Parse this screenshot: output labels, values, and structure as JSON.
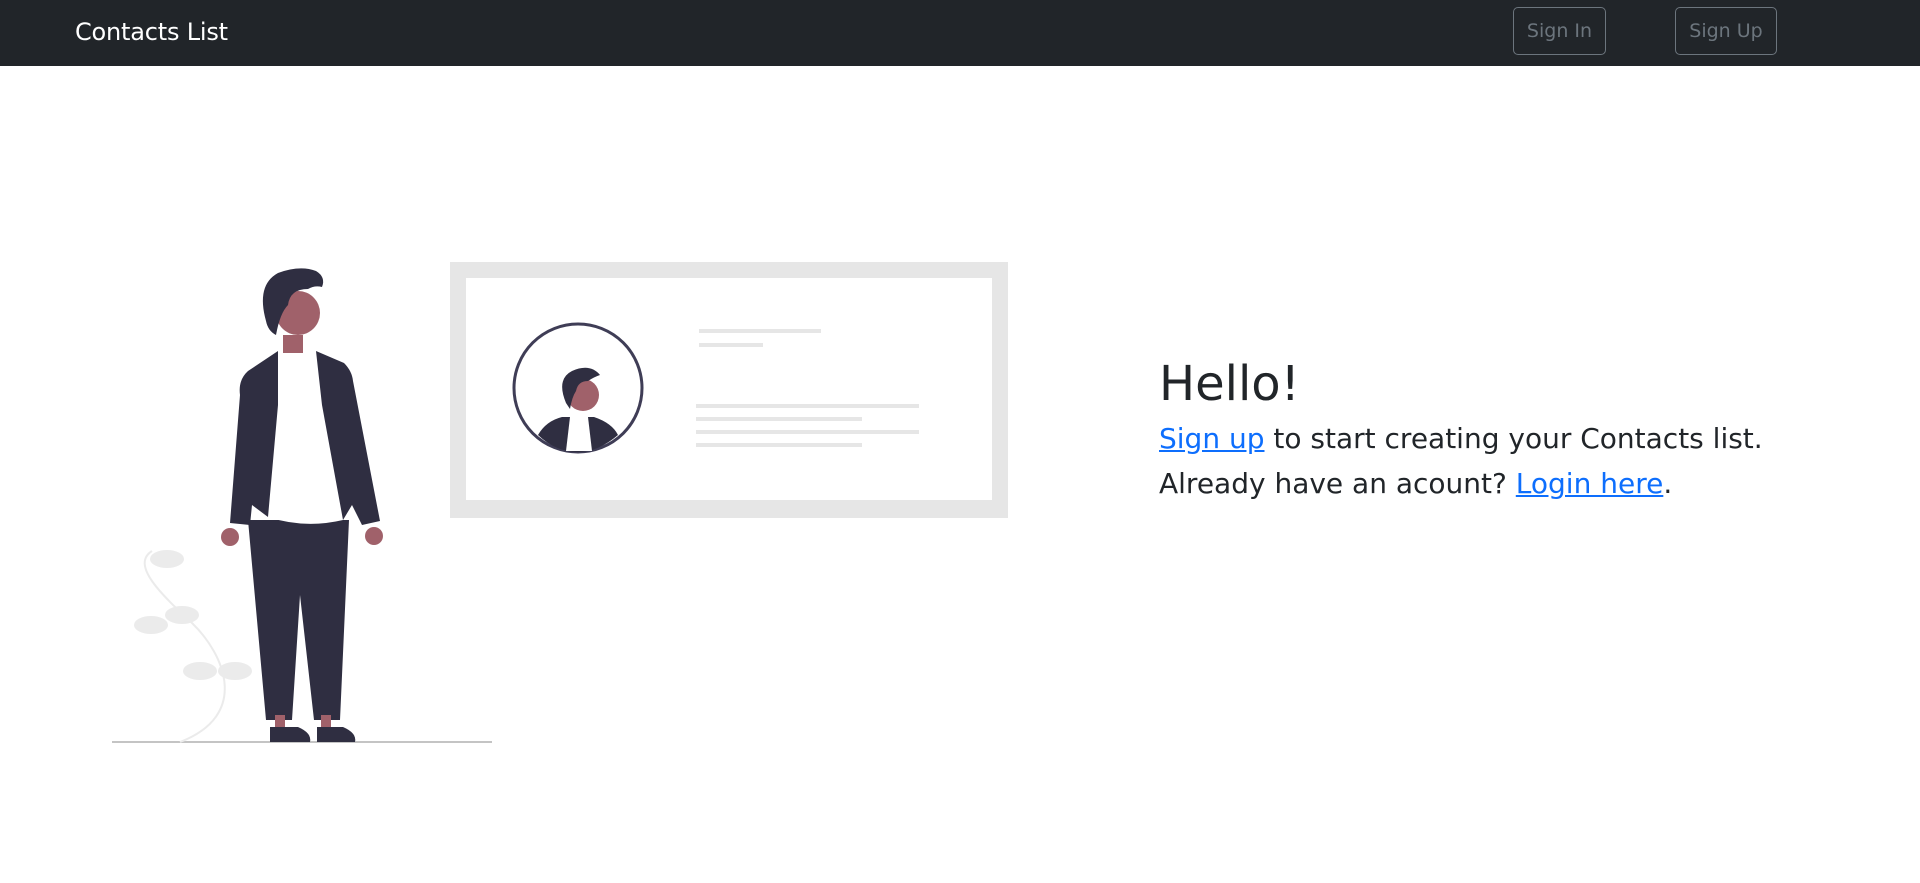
{
  "navbar": {
    "brand": "Contacts List",
    "sign_in_label": "Sign In",
    "sign_up_label": "Sign Up",
    "background": "#212529"
  },
  "hero": {
    "title": "Hello!",
    "line1": {
      "link": "Sign up",
      "text": " to start creating your Contacts list."
    },
    "line2": {
      "text": "Already have an acount? ",
      "link": "Login here",
      "suffix": "."
    },
    "link_color": "#0d6efd"
  },
  "illustration": {
    "name": "person-with-profile-card-illustration"
  }
}
